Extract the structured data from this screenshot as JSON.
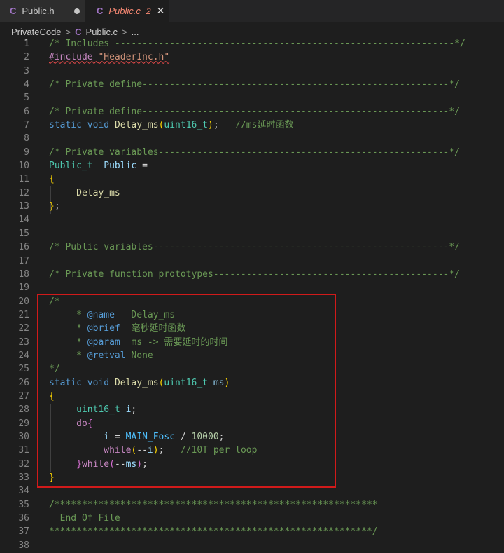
{
  "tabs": [
    {
      "icon": "C",
      "name": "Public.h",
      "active": false,
      "dirty": true
    },
    {
      "icon": "C",
      "name": "Public.c",
      "active": true,
      "problems": "2",
      "close": "✕"
    }
  ],
  "breadcrumb": {
    "folder": "PrivateCode",
    "sep": ">",
    "file_icon": "C",
    "file": "Public.c",
    "more": "..."
  },
  "line_numbers": [
    "1",
    "2",
    "3",
    "4",
    "5",
    "6",
    "7",
    "8",
    "9",
    "10",
    "11",
    "12",
    "13",
    "14",
    "15",
    "16",
    "17",
    "18",
    "19",
    "20",
    "21",
    "22",
    "23",
    "24",
    "25",
    "26",
    "27",
    "28",
    "29",
    "30",
    "31",
    "32",
    "33",
    "34",
    "35",
    "36",
    "37",
    "38"
  ],
  "code": {
    "l1": "/* Includes --------------------------------------------------------------*/",
    "l2a": "#include",
    "l2b": "\"HeaderInc.h\"",
    "l4": "/* Private define--------------------------------------------------------*/",
    "l6": "/* Private define--------------------------------------------------------*/",
    "l7_static": "static",
    "l7_void": "void",
    "l7_func": "Delay_ms",
    "l7_type": "uint16_t",
    "l7_comment": "//ms延时函数",
    "l9": "/* Private variables-----------------------------------------------------*/",
    "l10_type": "Public_t",
    "l10_var": "Public",
    "l12_member": "Delay_ms",
    "l16": "/* Public variables------------------------------------------------------*/",
    "l18": "/* Private function prototypes-------------------------------------------*/",
    "l20": "/*",
    "l21_star": "* ",
    "l21_tag": "@name",
    "l21_text": "   Delay_ms",
    "l22_tag": "@brief",
    "l22_text": "  毫秒延时函数",
    "l23_tag": "@param",
    "l23_text": "  ms -> 需要延时的时间",
    "l24_tag": "@retval",
    "l24_text": " None",
    "l25": "*/",
    "l26_static": "static",
    "l26_void": "void",
    "l26_func": "Delay_ms",
    "l26_type": "uint16_t",
    "l26_param": "ms",
    "l28_type": "uint16_t",
    "l28_var": "i",
    "l29_do": "do",
    "l30_var": "i",
    "l30_macro": "MAIN_Fosc",
    "l30_num": "10000",
    "l31_while": "while",
    "l31_var": "i",
    "l31_comment": "//10T per loop",
    "l32_while": "while",
    "l32_var": "ms",
    "l35": "/***********************************************************",
    "l36": "  End Of File",
    "l37": "***********************************************************/"
  }
}
